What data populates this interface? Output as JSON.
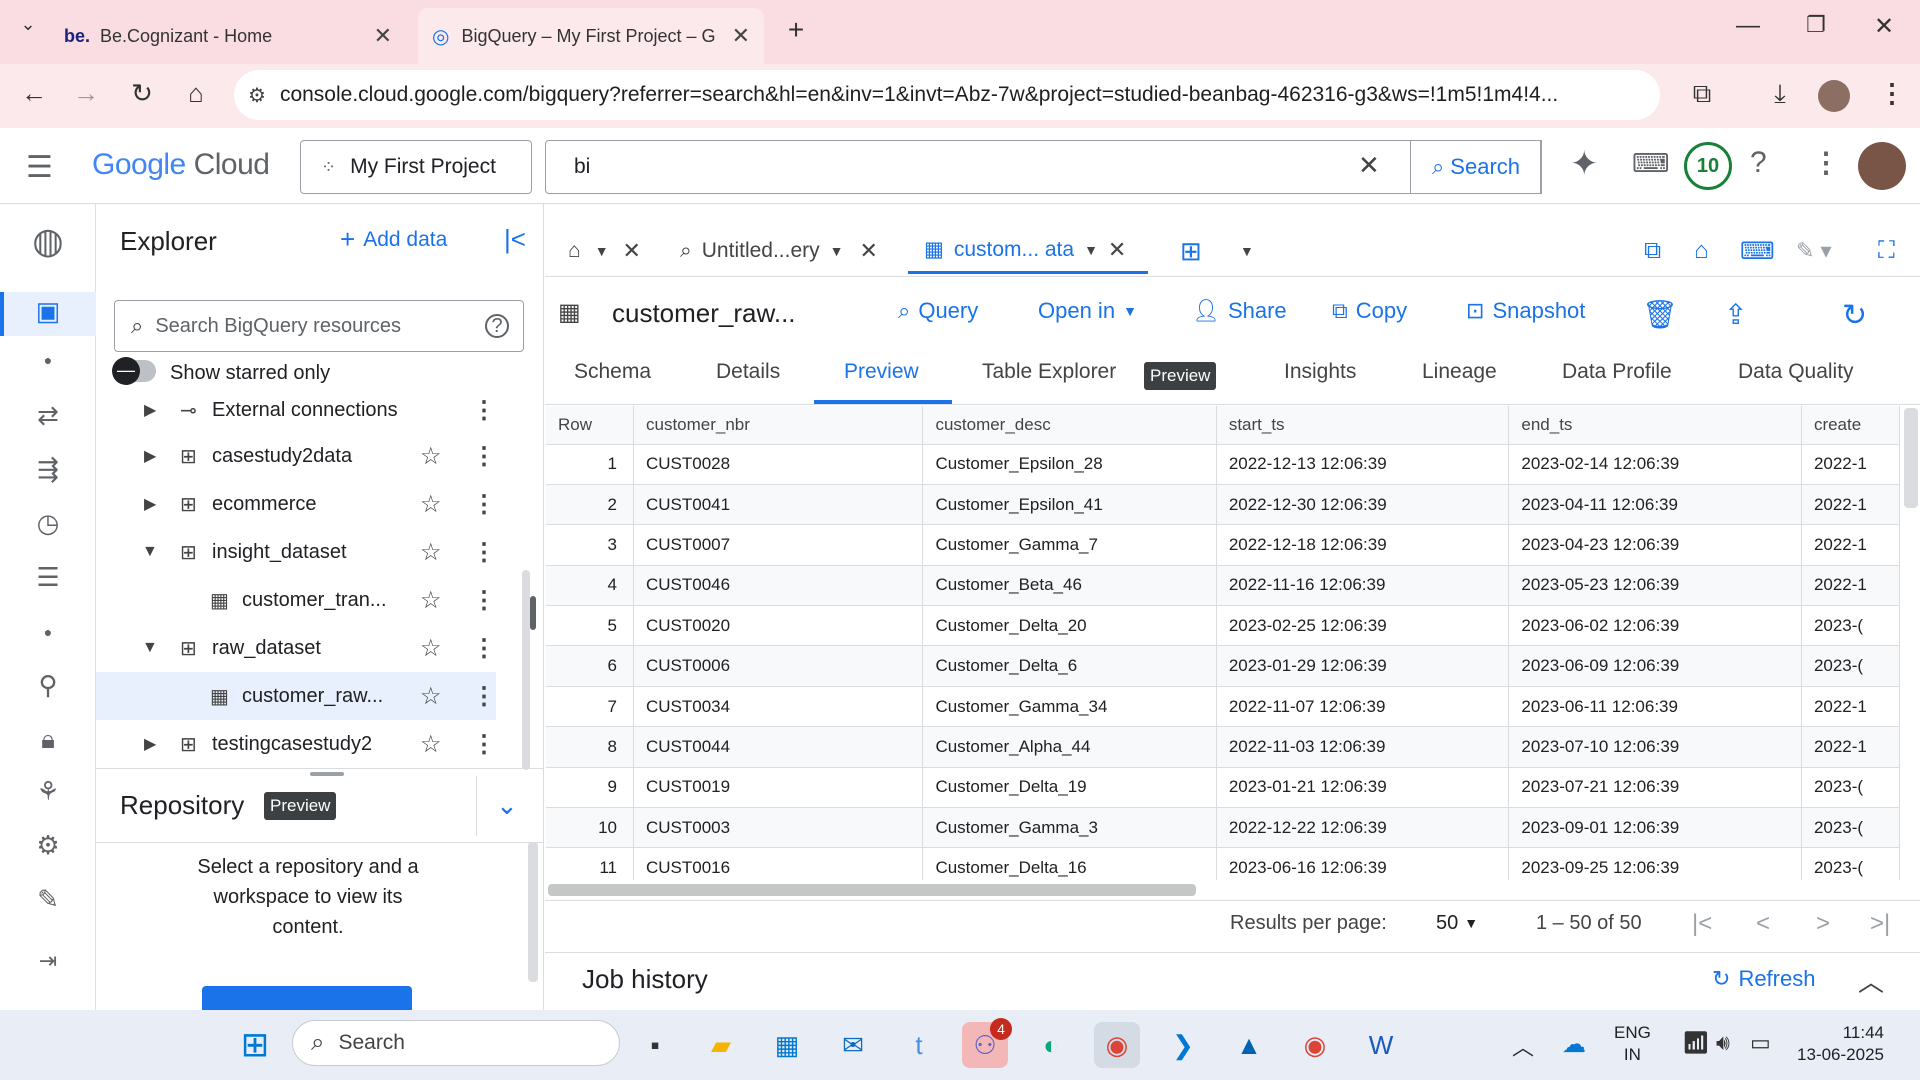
{
  "browser": {
    "tabs": [
      {
        "favicon": "be.",
        "title": "Be.Cognizant - Home"
      },
      {
        "title": "BigQuery – My First Project – G"
      }
    ],
    "url": "console.cloud.google.com/bigquery?referrer=search&hl=en&inv=1&invt=Abz-7w&project=studied-beanbag-462316-g3&ws=!1m5!1m4!4..."
  },
  "header": {
    "logo_google": "Google",
    "logo_cloud": "Cloud",
    "project": "My First Project",
    "search_value": "bi",
    "search_button": "Search",
    "notif_count": "10"
  },
  "explorer": {
    "title": "Explorer",
    "add_data": "Add data",
    "search_placeholder": "Search BigQuery resources",
    "show_starred": "Show starred only",
    "items": [
      {
        "label": "External connections"
      },
      {
        "label": "casestudy2data"
      },
      {
        "label": "ecommerce"
      },
      {
        "label": "insight_dataset"
      },
      {
        "label": "customer_tran..."
      },
      {
        "label": "raw_dataset"
      },
      {
        "label": "customer_raw..."
      },
      {
        "label": "testingcasestudy2"
      }
    ],
    "repository": "Repository",
    "preview_badge": "Preview",
    "repo_message": "Select a repository and a workspace to view its content."
  },
  "tabs": {
    "untitled": "Untitled...ery",
    "current": "custom... ata"
  },
  "table_header": {
    "name": "customer_raw...",
    "actions": [
      "Query",
      "Open in",
      "Share",
      "Copy",
      "Snapshot"
    ]
  },
  "subtabs": [
    "Schema",
    "Details",
    "Preview",
    "Table Explorer",
    "Insights",
    "Lineage",
    "Data Profile",
    "Data Quality"
  ],
  "grid": {
    "columns": [
      "Row",
      "customer_nbr",
      "customer_desc",
      "start_ts",
      "end_ts",
      "create"
    ],
    "rows": [
      [
        "1",
        "CUST0028",
        "Customer_Epsilon_28",
        "2022-12-13 12:06:39",
        "2023-02-14 12:06:39",
        "2022-1"
      ],
      [
        "2",
        "CUST0041",
        "Customer_Epsilon_41",
        "2022-12-30 12:06:39",
        "2023-04-11 12:06:39",
        "2022-1"
      ],
      [
        "3",
        "CUST0007",
        "Customer_Gamma_7",
        "2022-12-18 12:06:39",
        "2023-04-23 12:06:39",
        "2022-1"
      ],
      [
        "4",
        "CUST0046",
        "Customer_Beta_46",
        "2022-11-16 12:06:39",
        "2023-05-23 12:06:39",
        "2022-1"
      ],
      [
        "5",
        "CUST0020",
        "Customer_Delta_20",
        "2023-02-25 12:06:39",
        "2023-06-02 12:06:39",
        "2023-("
      ],
      [
        "6",
        "CUST0006",
        "Customer_Delta_6",
        "2023-01-29 12:06:39",
        "2023-06-09 12:06:39",
        "2023-("
      ],
      [
        "7",
        "CUST0034",
        "Customer_Gamma_34",
        "2022-11-07 12:06:39",
        "2023-06-11 12:06:39",
        "2022-1"
      ],
      [
        "8",
        "CUST0044",
        "Customer_Alpha_44",
        "2022-11-03 12:06:39",
        "2023-07-10 12:06:39",
        "2022-1"
      ],
      [
        "9",
        "CUST0019",
        "Customer_Delta_19",
        "2023-01-21 12:06:39",
        "2023-07-21 12:06:39",
        "2023-("
      ],
      [
        "10",
        "CUST0003",
        "Customer_Gamma_3",
        "2022-12-22 12:06:39",
        "2023-09-01 12:06:39",
        "2023-("
      ],
      [
        "11",
        "CUST0016",
        "Customer_Delta_16",
        "2023-06-16 12:06:39",
        "2023-09-25 12:06:39",
        "2023-("
      ]
    ]
  },
  "pagination": {
    "label": "Results per page:",
    "per_page": "50",
    "range": "1 – 50 of 50"
  },
  "job_history": {
    "title": "Job history",
    "refresh": "Refresh"
  },
  "taskbar": {
    "search": "Search",
    "lang1": "ENG",
    "lang2": "IN",
    "time": "11:44",
    "date": "13-06-2025",
    "teams_badge": "4"
  },
  "colors": {
    "accent": "#1a73e8",
    "chrome_tab": "#f9dde3",
    "selected_row": "#e8f0fe"
  }
}
